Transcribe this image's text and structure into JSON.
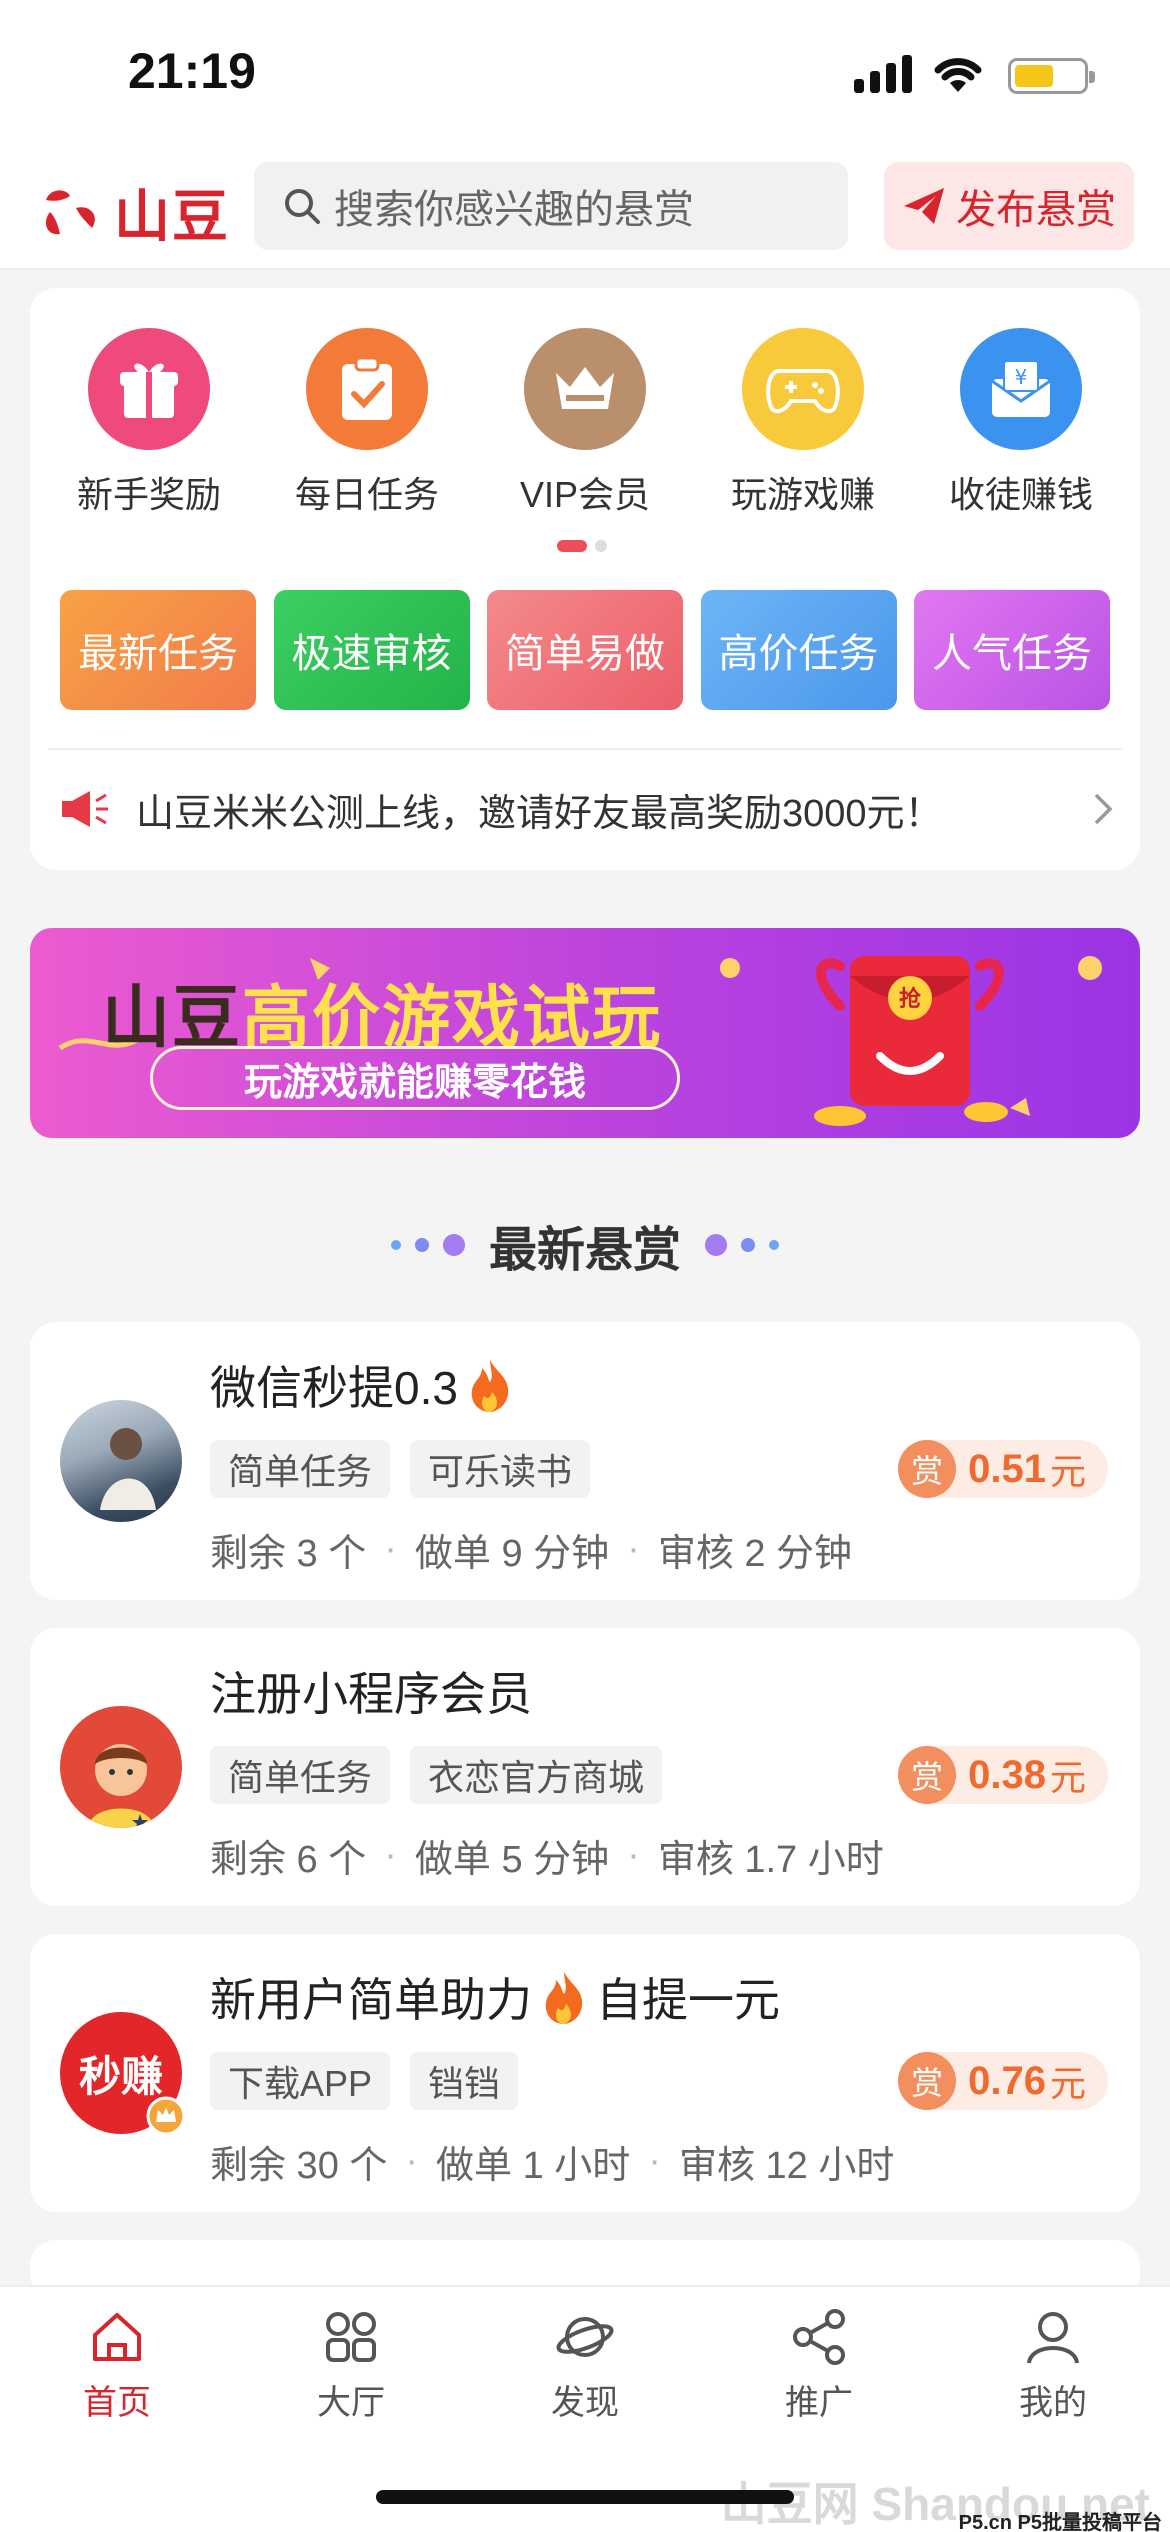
{
  "status_bar": {
    "time": "21:19"
  },
  "header": {
    "logo_text": "山豆",
    "search_placeholder": "搜索你感兴趣的悬赏",
    "publish_label": "发布悬赏"
  },
  "quick_icons": [
    {
      "label": "新手奖励",
      "icon": "gift-icon",
      "color": "#ef4a7c"
    },
    {
      "label": "每日任务",
      "icon": "clipboard-icon",
      "color": "#f47a3a"
    },
    {
      "label": "VIP会员",
      "icon": "crown-icon",
      "color": "#b9906b"
    },
    {
      "label": "玩游戏赚",
      "icon": "gamepad-icon",
      "color": "#f7c93b"
    },
    {
      "label": "收徒赚钱",
      "icon": "envelope-yen-icon",
      "color": "#3b93f0"
    }
  ],
  "categories": [
    {
      "label": "最新任务",
      "from": "#f8a244",
      "to": "#f27b4c"
    },
    {
      "label": "极速审核",
      "from": "#3ccf61",
      "to": "#23b34a"
    },
    {
      "label": "简单易做",
      "from": "#f48a8a",
      "to": "#ec5f6a"
    },
    {
      "label": "高价任务",
      "from": "#6cb6f5",
      "to": "#4c96ee"
    },
    {
      "label": "人气任务",
      "from": "#e178f0",
      "to": "#bb52e6"
    }
  ],
  "notice": {
    "text": "山豆米米公测上线，邀请好友最高奖励3000元！"
  },
  "banner": {
    "brand": "山豆",
    "title": "高价游戏试玩",
    "subtitle": "玩游戏就能赚零花钱",
    "envelope_char": "抢"
  },
  "section": {
    "title": "最新悬赏"
  },
  "tasks": [
    {
      "title": "微信秒提0.3",
      "tags": [
        "简单任务",
        "可乐读书"
      ],
      "remaining": "剩余 3 个",
      "duration": "做单 9 分钟",
      "review": "审核 2 分钟",
      "reward_badge": "赏",
      "amount": "0.51",
      "unit": "元"
    },
    {
      "title": "注册小程序会员",
      "tags": [
        "简单任务",
        "衣恋官方商城"
      ],
      "remaining": "剩余 6 个",
      "duration": "做单 5 分钟",
      "review": "审核 1.7 小时",
      "reward_badge": "赏",
      "amount": "0.38",
      "unit": "元"
    },
    {
      "title": "新用户简单助力",
      "title_suffix": "自提一元",
      "tags": [
        "下载APP",
        "铛铛"
      ],
      "avatar_text": "秒赚",
      "remaining": "剩余 30 个",
      "duration": "做单 1 小时",
      "review": "审核 12 小时",
      "reward_badge": "赏",
      "amount": "0.76",
      "unit": "元"
    }
  ],
  "tabbar": [
    {
      "label": "首页",
      "icon": "home-icon",
      "active": true
    },
    {
      "label": "大厅",
      "icon": "grid-icon",
      "active": false
    },
    {
      "label": "发现",
      "icon": "planet-icon",
      "active": false
    },
    {
      "label": "推广",
      "icon": "share-icon",
      "active": false
    },
    {
      "label": "我的",
      "icon": "user-icon",
      "active": false
    }
  ],
  "watermark": {
    "main": "山豆网 Shandou.net",
    "small": "P5.cn P5批量投稿平台"
  }
}
